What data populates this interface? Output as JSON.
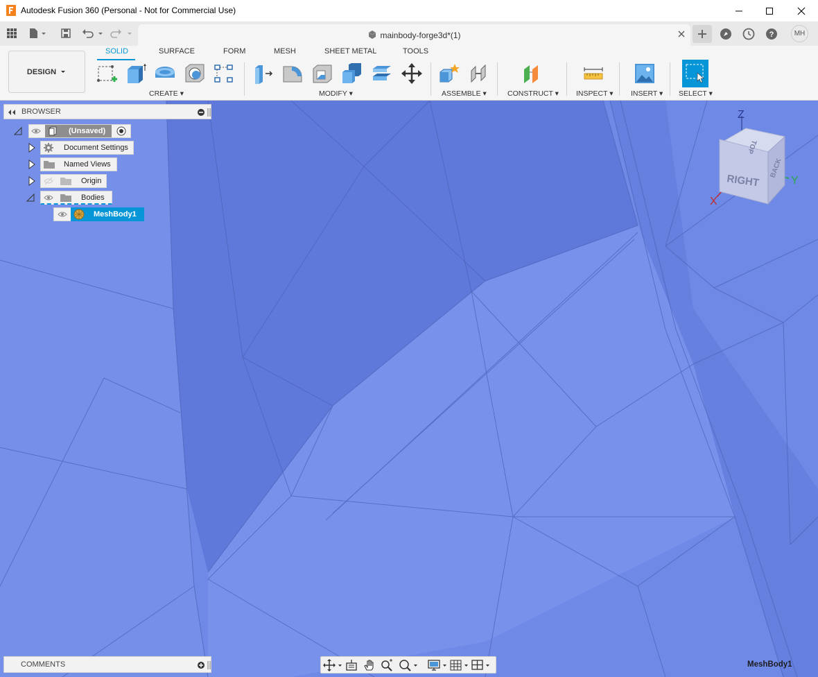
{
  "window": {
    "title": "Autodesk Fusion 360 (Personal - Not for Commercial Use)",
    "minimize_icon": "minimize-icon",
    "maximize_icon": "maximize-icon",
    "close_icon": "close-icon"
  },
  "tabbar": {
    "document_title": "mainbody-forge3d*(1)",
    "user_initials": "MH"
  },
  "toolbar": {
    "workspace": "DESIGN",
    "tabs": [
      "SOLID",
      "SURFACE",
      "FORM",
      "MESH",
      "SHEET METAL",
      "TOOLS"
    ],
    "active_tab": "SOLID",
    "groups": [
      "CREATE",
      "MODIFY",
      "ASSEMBLE",
      "CONSTRUCT",
      "INSPECT",
      "INSERT",
      "SELECT"
    ]
  },
  "browser": {
    "title": "BROWSER",
    "root": "(Unsaved)",
    "items": [
      "Document Settings",
      "Named Views",
      "Origin",
      "Bodies"
    ],
    "body": "MeshBody1"
  },
  "comments": {
    "title": "COMMENTS"
  },
  "viewcube": {
    "faces": [
      "RIGHT",
      "TOP",
      "BACK"
    ],
    "axes": [
      "Z",
      "X",
      "Y"
    ]
  },
  "status": {
    "selection": "MeshBody1"
  },
  "colors": {
    "accent": "#0696d7",
    "viewport": "#6f89e6",
    "mesh_lines": "#4a5fb0"
  }
}
